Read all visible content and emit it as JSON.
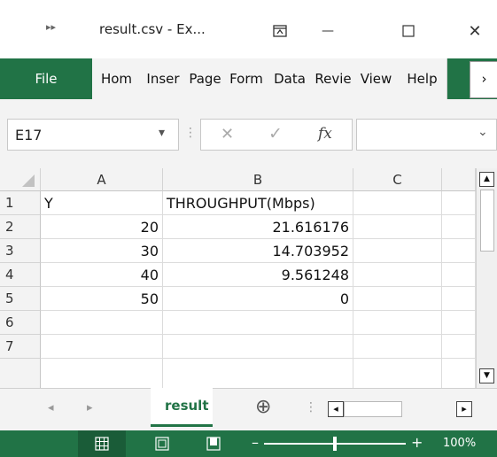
{
  "window": {
    "title": "result.csv  -  Ex...",
    "nav_glyph": "▸▸",
    "ribbon_display_glyph": "⊼",
    "minimize_glyph": "—",
    "maximize_glyph": "☐",
    "close_glyph": "✕"
  },
  "ribbon": {
    "file_label": "File",
    "tabs": [
      "Hom",
      "Inser",
      "Page",
      "Form",
      "Data",
      "Revie",
      "View",
      "Help"
    ],
    "more_glyph": "›"
  },
  "formula_bar": {
    "name_box": "E17",
    "name_dropdown_glyph": "▾",
    "dots_glyph": "⋮",
    "cancel_glyph": "✕",
    "enter_glyph": "✓",
    "fx_label": "fx",
    "formula_value": "",
    "expand_glyph": "⌄"
  },
  "grid": {
    "columns": [
      "A",
      "B",
      "C"
    ],
    "rows": [
      "1",
      "2",
      "3",
      "4",
      "5",
      "6",
      "7"
    ],
    "cells": [
      [
        "Y",
        "THROUGHPUT(Mbps)",
        ""
      ],
      [
        "20",
        "21.616176",
        ""
      ],
      [
        "30",
        "14.703952",
        ""
      ],
      [
        "40",
        "9.561248",
        ""
      ],
      [
        "50",
        "0",
        ""
      ],
      [
        "",
        "",
        ""
      ],
      [
        "",
        "",
        ""
      ]
    ],
    "scroll_up_glyph": "▲",
    "scroll_down_glyph": "▼"
  },
  "sheets": {
    "prev_glyph": "◂",
    "next_glyph": "▸",
    "active_sheet": "result",
    "add_glyph": "⊕",
    "dots_glyph": "⋮",
    "hscroll_left_glyph": "◂",
    "hscroll_right_glyph": "▸"
  },
  "status": {
    "zoom_minus": "–",
    "zoom_plus": "+",
    "zoom": "100%",
    "zoom_level": 0.5
  }
}
